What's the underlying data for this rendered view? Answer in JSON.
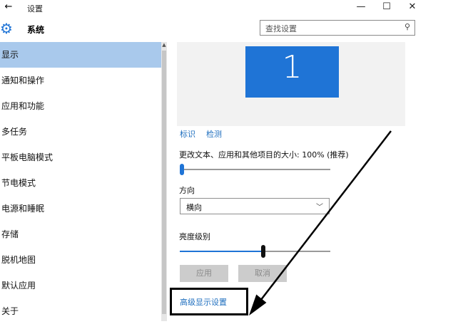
{
  "window": {
    "back_icon": "←",
    "title": "设置",
    "minimize_icon": "—",
    "maximize_icon": "☐",
    "close_icon": "✕"
  },
  "header": {
    "title": "系统",
    "gear_icon": "⚙",
    "search_placeholder": "查找设置",
    "search_icon": "⚲"
  },
  "sidebar": {
    "items": [
      {
        "label": "显示"
      },
      {
        "label": "通知和操作"
      },
      {
        "label": "应用和功能"
      },
      {
        "label": "多任务"
      },
      {
        "label": "平板电脑模式"
      },
      {
        "label": "节电模式"
      },
      {
        "label": "电源和睡眠"
      },
      {
        "label": "存储"
      },
      {
        "label": "脱机地图"
      },
      {
        "label": "默认应用"
      },
      {
        "label": "关于"
      }
    ]
  },
  "main": {
    "monitor_number": "1",
    "identify_link": "标识",
    "detect_link": "检测",
    "scale_label": "更改文本、应用和其他项目的大小: 100% (推荐)",
    "scale_value": 0,
    "orientation_label": "方向",
    "orientation_value": "横向",
    "brightness_label": "亮度级别",
    "brightness_value": 0.55,
    "apply_button": "应用",
    "cancel_button": "取消",
    "advanced_link": "高级显示设置"
  },
  "colors": {
    "accent": "#1f74d6",
    "selected_bg": "#a9c9ec",
    "link": "#1f6fbf",
    "annotation": "#000000"
  }
}
